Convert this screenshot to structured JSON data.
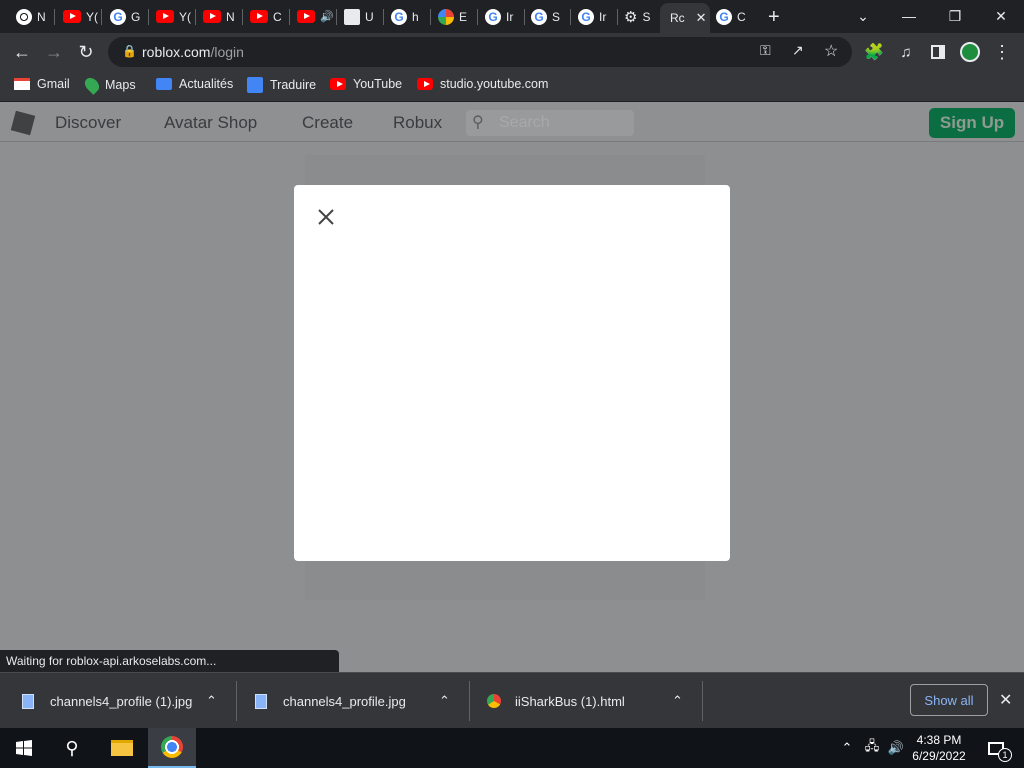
{
  "tabs": [
    {
      "letter": "N",
      "icon": "chrome-icon"
    },
    {
      "letter": "Y(",
      "icon": "youtube-icon"
    },
    {
      "letter": "G",
      "icon": "google-icon"
    },
    {
      "letter": "Y(",
      "icon": "youtube-icon"
    },
    {
      "letter": "N",
      "icon": "youtube-icon"
    },
    {
      "letter": "C",
      "icon": "youtube-icon"
    },
    {
      "letter": "",
      "icon": "youtube-icon"
    },
    {
      "letter": "U",
      "icon": "page-icon"
    },
    {
      "letter": "h",
      "icon": "google-icon"
    },
    {
      "letter": "E",
      "icon": "photos-icon"
    },
    {
      "letter": "Ir",
      "icon": "google-icon"
    },
    {
      "letter": "S",
      "icon": "google-icon"
    },
    {
      "letter": "Ir",
      "icon": "google-icon"
    },
    {
      "letter": "S",
      "icon": "settings-icon"
    },
    {
      "letter": "Rc",
      "icon": "roblox-icon"
    },
    {
      "letter": "C",
      "icon": "google-icon"
    }
  ],
  "toolbar": {
    "url_host": "roblox.com",
    "url_path": "/login"
  },
  "bookmarks": [
    {
      "label": "Gmail",
      "icon": "gmail-icon"
    },
    {
      "label": "Maps",
      "icon": "maps-icon"
    },
    {
      "label": "Actualités",
      "icon": "news-icon"
    },
    {
      "label": "Traduire",
      "icon": "translate-icon"
    },
    {
      "label": "YouTube",
      "icon": "youtube-icon"
    },
    {
      "label": "studio.youtube.com",
      "icon": "youtube-icon"
    }
  ],
  "roblox_nav": {
    "links": [
      "Discover",
      "Avatar Shop",
      "Create",
      "Robux"
    ],
    "search_placeholder": "Search",
    "signup_label": "Sign Up"
  },
  "status_text": "Waiting for roblox-api.arkoselabs.com...",
  "downloads": [
    {
      "name": "channels4_profile (1).jpg",
      "icon": "image-file-icon"
    },
    {
      "name": "channels4_profile.jpg",
      "icon": "image-file-icon"
    },
    {
      "name": "iiSharkBus (1).html",
      "icon": "chrome-icon"
    }
  ],
  "downloads_show_all": "Show all",
  "taskbar": {
    "time": "4:38 PM",
    "date": "6/29/2022",
    "notification_count": "1"
  }
}
